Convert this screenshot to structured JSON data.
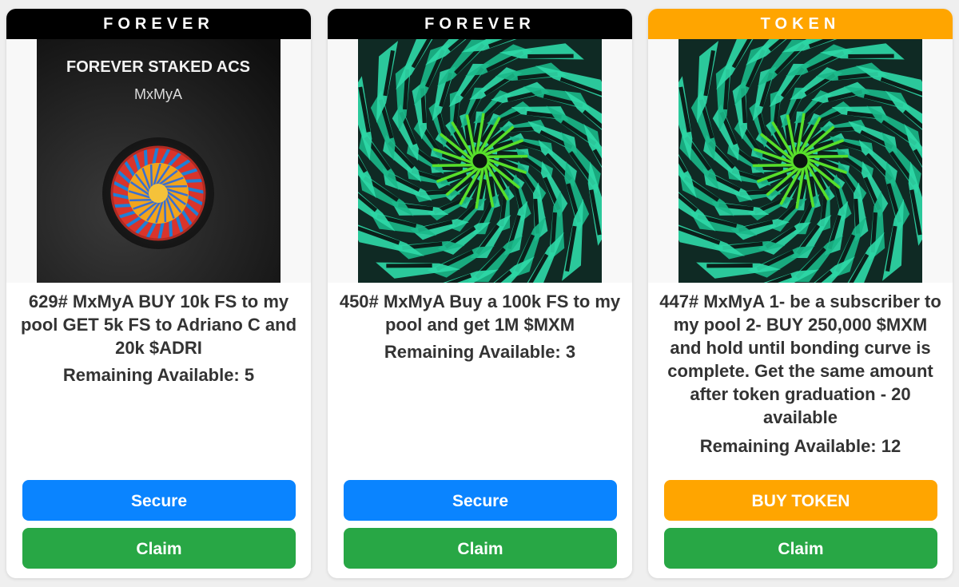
{
  "cards": [
    {
      "banner": "FOREVER",
      "banner_color": "#000000",
      "image": {
        "kind": "forever-staked-acs-art",
        "headline": "FOREVER STAKED ACS",
        "sub": "MxMyA"
      },
      "description": "629# MxMyA BUY 10k FS to my pool GET 5k FS to Adriano C and 20k $ADRI",
      "remaining": "Remaining Available: 5",
      "primary_button": "Secure",
      "claim_button": "Claim"
    },
    {
      "banner": "FOREVER",
      "banner_color": "#000000",
      "image": {
        "kind": "green-spiral-kaleidoscope"
      },
      "description": "450# MxMyA Buy a 100k FS to my pool and get 1M $MXM",
      "remaining": "Remaining Available: 3",
      "primary_button": "Secure",
      "claim_button": "Claim"
    },
    {
      "banner": "TOKEN",
      "banner_color": "#ffa500",
      "image": {
        "kind": "green-spiral-kaleidoscope"
      },
      "description": "447# MxMyA 1- be a subscriber to my pool 2- BUY 250,000 $MXM and hold until bonding curve is complete. Get the same amount after token graduation - 20 available",
      "remaining": "Remaining Available: 12",
      "primary_button": "BUY TOKEN",
      "claim_button": "Claim"
    }
  ],
  "colors": {
    "secure_blue": "#0a84ff",
    "claim_green": "#28a745",
    "token_orange": "#ffa500"
  }
}
